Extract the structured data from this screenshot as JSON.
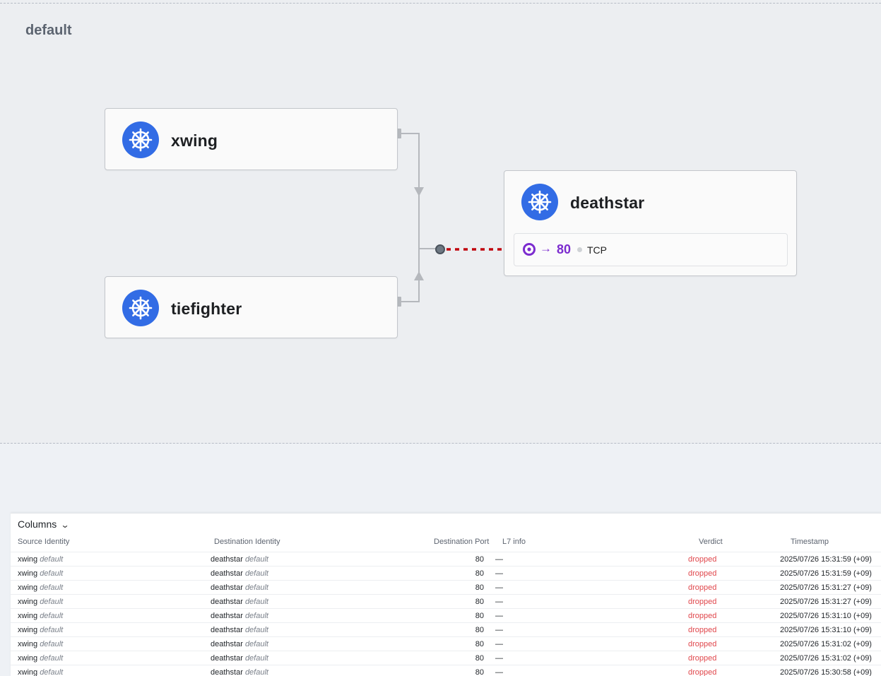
{
  "namespace": "default",
  "services": {
    "xwing": {
      "name": "xwing",
      "icon": "kubernetes-icon"
    },
    "tiefighter": {
      "name": "tiefighter",
      "icon": "kubernetes-icon"
    },
    "deathstar": {
      "name": "deathstar",
      "icon": "kubernetes-icon",
      "endpoint": {
        "arrow": "→",
        "port": "80",
        "protocol": "TCP"
      }
    }
  },
  "colors": {
    "k8s_blue": "#326ce5",
    "dropped_red": "#e0474c",
    "endpoint_purple": "#7c2ccf",
    "edge_dropped": "#c0000c"
  },
  "flows": {
    "columns_label": "Columns",
    "headers": {
      "source": "Source Identity",
      "destination": "Destination Identity",
      "port": "Destination Port",
      "l7": "L7 info",
      "verdict": "Verdict",
      "timestamp": "Timestamp"
    },
    "rows": [
      {
        "src": "xwing",
        "src_ns": "default",
        "dst": "deathstar",
        "dst_ns": "default",
        "port": "80",
        "l7": "—",
        "verdict": "dropped",
        "ts": "2025/07/26 15:31:59 (+09)"
      },
      {
        "src": "xwing",
        "src_ns": "default",
        "dst": "deathstar",
        "dst_ns": "default",
        "port": "80",
        "l7": "—",
        "verdict": "dropped",
        "ts": "2025/07/26 15:31:59 (+09)"
      },
      {
        "src": "xwing",
        "src_ns": "default",
        "dst": "deathstar",
        "dst_ns": "default",
        "port": "80",
        "l7": "—",
        "verdict": "dropped",
        "ts": "2025/07/26 15:31:27 (+09)"
      },
      {
        "src": "xwing",
        "src_ns": "default",
        "dst": "deathstar",
        "dst_ns": "default",
        "port": "80",
        "l7": "—",
        "verdict": "dropped",
        "ts": "2025/07/26 15:31:27 (+09)"
      },
      {
        "src": "xwing",
        "src_ns": "default",
        "dst": "deathstar",
        "dst_ns": "default",
        "port": "80",
        "l7": "—",
        "verdict": "dropped",
        "ts": "2025/07/26 15:31:10 (+09)"
      },
      {
        "src": "xwing",
        "src_ns": "default",
        "dst": "deathstar",
        "dst_ns": "default",
        "port": "80",
        "l7": "—",
        "verdict": "dropped",
        "ts": "2025/07/26 15:31:10 (+09)"
      },
      {
        "src": "xwing",
        "src_ns": "default",
        "dst": "deathstar",
        "dst_ns": "default",
        "port": "80",
        "l7": "—",
        "verdict": "dropped",
        "ts": "2025/07/26 15:31:02 (+09)"
      },
      {
        "src": "xwing",
        "src_ns": "default",
        "dst": "deathstar",
        "dst_ns": "default",
        "port": "80",
        "l7": "—",
        "verdict": "dropped",
        "ts": "2025/07/26 15:31:02 (+09)"
      },
      {
        "src": "xwing",
        "src_ns": "default",
        "dst": "deathstar",
        "dst_ns": "default",
        "port": "80",
        "l7": "—",
        "verdict": "dropped",
        "ts": "2025/07/26 15:30:58 (+09)"
      }
    ]
  }
}
